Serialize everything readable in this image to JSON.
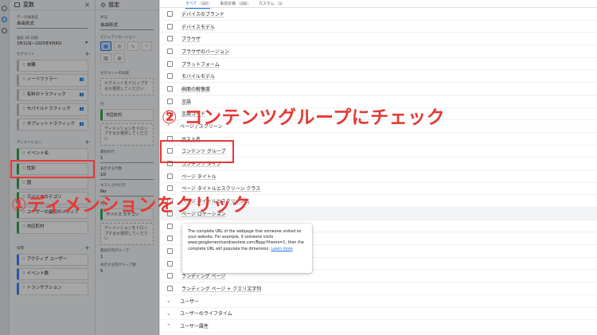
{
  "variables_panel": {
    "title": "変数",
    "explore_name_label": "データ探索名",
    "explore_name": "自由形式",
    "date_label": "過去 28 日間",
    "date_range": "3月12日～2025年4月8日",
    "segments_heading": "セグメント",
    "segments": [
      "未購",
      "ノーリファラー",
      "有料のトラフィック",
      "モバイルトラフィック",
      "タブレットトラフィック"
    ],
    "dimensions_heading": "ディメンション",
    "dimensions": [
      "イベント名",
      "性別",
      "国",
      "デバイスカテゴリ",
      "ユーザーの最初のメディア",
      "市区町村"
    ],
    "metrics_heading": "指標",
    "metrics": [
      "アクティブ ユーザー",
      "イベント数",
      "トランザクション"
    ]
  },
  "settings_panel": {
    "title": "設定",
    "technique_label": "手法",
    "technique": "自由形式",
    "viz_label": "ビジュアリゼーション",
    "viz_icons": [
      "table-icon",
      "donut-icon",
      "line-icon",
      "scatter-icon",
      "bar-icon",
      "geo-icon"
    ],
    "segment_compare_label": "セグメントの比較",
    "segment_drop": "セグメントをドロップするか選択してください",
    "rows_label": "行",
    "row_chip": "市区町村",
    "row_drop": "ディメンションをドロップするか選択してください",
    "start_row_label": "最初の行",
    "start_row": "1",
    "show_rows_label": "表示する行数",
    "show_rows": "10",
    "nested_rows_label": "ネストされた行",
    "nested_rows": "No",
    "columns_label": "列",
    "col_chip": "デバイス カテゴリ",
    "col_drop": "ディメンションをドロップするか選択してください",
    "start_col_label": "最初の列グループ",
    "start_col": "1",
    "show_cols_label": "表示する列グループ数",
    "show_cols": "5"
  },
  "picker": {
    "tabs": [
      {
        "label": "すべて",
        "count": "237"
      },
      {
        "label": "事前定義",
        "count": "236"
      },
      {
        "label": "カスタム",
        "count": "1"
      }
    ],
    "rows_top": [
      "デバイスのブランド",
      "デバイスモデル",
      "ブラウザ",
      "ブラウザのバージョン",
      "プラットフォーム",
      "モバイルモデル",
      "画面の解像度",
      "言語",
      "言語コード"
    ],
    "group_page": "ページ / スクリーン",
    "rows_page": [
      "ホスト名",
      "コンテンツ グループ",
      "コンテンツ タイプ",
      "ページ タイトル",
      "ページ タイトルとスクリーン クラス",
      "ページ タイトルとスクリーン名",
      "ページ ロケーション",
      "",
      "",
      "",
      "",
      "ランディング ページ",
      "ランディング ページ + クエリ文字列"
    ],
    "groups_bottom": [
      "ユーザー",
      "ユーザーのライフタイム",
      "ユーザー属性"
    ],
    "tooltip_text": "The complete URL of the webpage that someone visited on your website. For example, if someone visits www.googlemerchandisestore.com/Bags?theme=1, then the complete URL will populate the dimension.",
    "tooltip_link": "Learn more"
  },
  "annotations": {
    "step1": "①ディメンションをクリック",
    "step2": "② コンテンツグループにチェック",
    "color": "#e53935"
  }
}
